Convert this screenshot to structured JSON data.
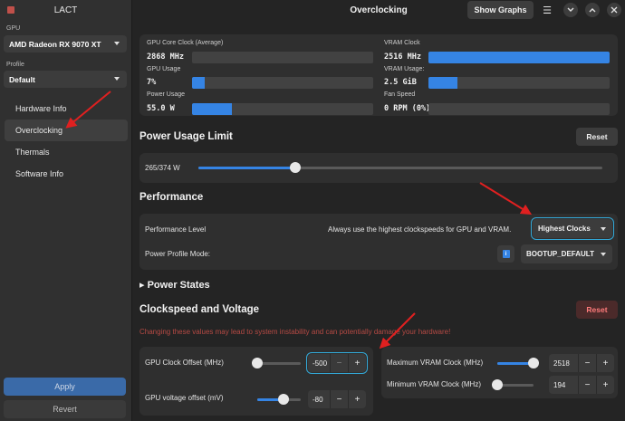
{
  "sidebar": {
    "title": "LACT",
    "gpu_label": "GPU",
    "gpu_value": "AMD Radeon RX 9070 XT",
    "profile_label": "Profile",
    "profile_value": "Default",
    "items": [
      {
        "label": "Hardware Info"
      },
      {
        "label": "Overclocking",
        "active": true
      },
      {
        "label": "Thermals"
      },
      {
        "label": "Software Info"
      }
    ],
    "apply_label": "Apply",
    "revert_label": "Revert"
  },
  "header": {
    "title": "Overclocking",
    "show_graphs_label": "Show Graphs",
    "icons": [
      "menu-icon",
      "chevron-down-icon",
      "chevron-up-icon",
      "close-icon"
    ]
  },
  "stats": {
    "core_clock_label": "GPU Core Clock (Average)",
    "core_clock_value": "2868 MHz",
    "core_clock_fraction": 0.0,
    "usage_label": "GPU Usage",
    "usage_value": "7%",
    "usage_fraction": 0.07,
    "power_label": "Power Usage",
    "power_value": "55.0 W",
    "power_fraction": 0.22,
    "vram_clock_label": "VRAM Clock",
    "vram_clock_value": "2516 MHz",
    "vram_clock_fraction": 1.0,
    "vram_usage_label": "VRAM Usage:",
    "vram_usage_value": "2.5 GiB",
    "vram_usage_fraction": 0.16,
    "fan_label": "Fan Speed",
    "fan_value": "0 RPM (0%)",
    "fan_fraction": 0.0
  },
  "power_limit": {
    "title": "Power Usage Limit",
    "reset_label": "Reset",
    "value_text": "265/374 W",
    "slider_fraction": 0.24
  },
  "performance": {
    "title": "Performance",
    "level_label": "Performance Level",
    "level_desc": "Always use the highest clockspeeds for GPU and VRAM.",
    "level_value": "Highest Clocks",
    "profile_mode_label": "Power Profile Mode:",
    "profile_mode_value": "BOOTUP_DEFAULT",
    "info_glyph": "i"
  },
  "power_states": {
    "title": "Power States",
    "arrow": "▸"
  },
  "clockspeed": {
    "title": "Clockspeed and Voltage",
    "reset_label": "Reset",
    "warning": "Changing these values may lead to system instability and can potentially damage your hardware!",
    "gpu_offset_label": "GPU Clock Offset (MHz)",
    "gpu_offset_value": "-500",
    "gpu_offset_fraction": 0.0,
    "voltage_offset_label": "GPU voltage offset (mV)",
    "voltage_offset_value": "-80",
    "voltage_offset_fraction": 0.6,
    "max_vram_label": "Maximum VRAM Clock (MHz)",
    "max_vram_value": "2518",
    "max_vram_fraction": 1.0,
    "min_vram_label": "Minimum VRAM Clock (MHz)",
    "min_vram_value": "194",
    "min_vram_fraction": 0.0,
    "minus": "−",
    "plus": "+"
  },
  "colors": {
    "accent": "#3584e4",
    "annotation_arrow": "#e02020",
    "highlight": "#33a9d8",
    "danger": "#b64a44"
  }
}
